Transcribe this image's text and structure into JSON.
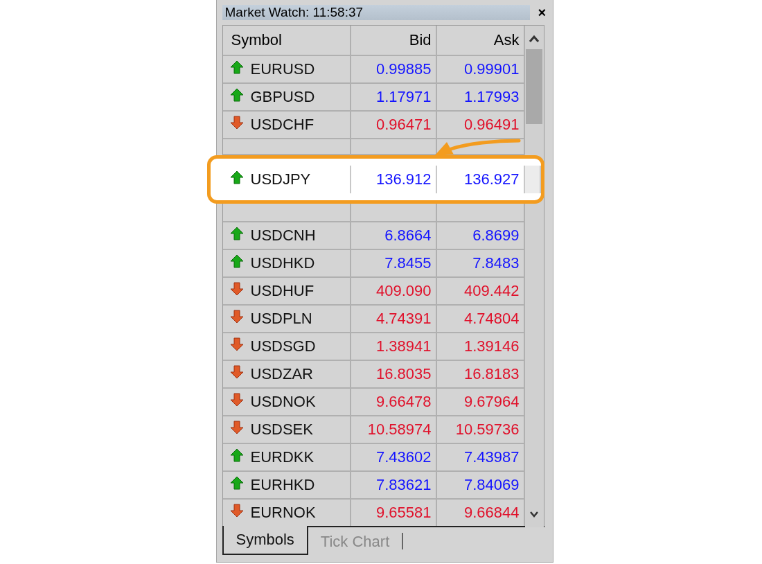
{
  "window": {
    "title": "Market Watch: 11:58:37",
    "close": "×"
  },
  "table": {
    "columns": [
      "Symbol",
      "Bid",
      "Ask"
    ],
    "rows": [
      {
        "symbol": "EURUSD",
        "bid": "0.99885",
        "ask": "0.99901",
        "kind": "up",
        "highlighted": false
      },
      {
        "symbol": "GBPUSD",
        "bid": "1.17971",
        "ask": "1.17993",
        "kind": "up",
        "highlighted": false
      },
      {
        "symbol": "USDCHF",
        "bid": "0.96471",
        "ask": "0.96491",
        "kind": "down",
        "highlighted": false
      },
      {
        "symbol": "USDJPY",
        "bid": "136.912",
        "ask": "136.927",
        "kind": "up",
        "highlighted": true
      },
      {
        "symbol": "USDCNH",
        "bid": "6.8664",
        "ask": "6.8699",
        "kind": "up",
        "highlighted": false
      },
      {
        "symbol": "USDHKD",
        "bid": "7.8455",
        "ask": "7.8483",
        "kind": "up",
        "highlighted": false
      },
      {
        "symbol": "USDHUF",
        "bid": "409.090",
        "ask": "409.442",
        "kind": "down",
        "highlighted": false
      },
      {
        "symbol": "USDPLN",
        "bid": "4.74391",
        "ask": "4.74804",
        "kind": "down",
        "highlighted": false
      },
      {
        "symbol": "USDSGD",
        "bid": "1.38941",
        "ask": "1.39146",
        "kind": "down",
        "highlighted": false
      },
      {
        "symbol": "USDZAR",
        "bid": "16.8035",
        "ask": "16.8183",
        "kind": "down",
        "highlighted": false
      },
      {
        "symbol": "USDNOK",
        "bid": "9.66478",
        "ask": "9.67964",
        "kind": "down",
        "highlighted": false
      },
      {
        "symbol": "USDSEK",
        "bid": "10.58974",
        "ask": "10.59736",
        "kind": "down",
        "highlighted": false
      },
      {
        "symbol": "EURDKK",
        "bid": "7.43602",
        "ask": "7.43987",
        "kind": "up",
        "highlighted": false
      },
      {
        "symbol": "EURHKD",
        "bid": "7.83621",
        "ask": "7.84069",
        "kind": "up",
        "highlighted": false
      },
      {
        "symbol": "EURNOK",
        "bid": "9.65581",
        "ask": "9.66844",
        "kind": "down",
        "highlighted": false
      }
    ]
  },
  "tabs": [
    {
      "label": "Symbols",
      "selected": true
    },
    {
      "label": "Tick Chart",
      "selected": false
    }
  ]
}
